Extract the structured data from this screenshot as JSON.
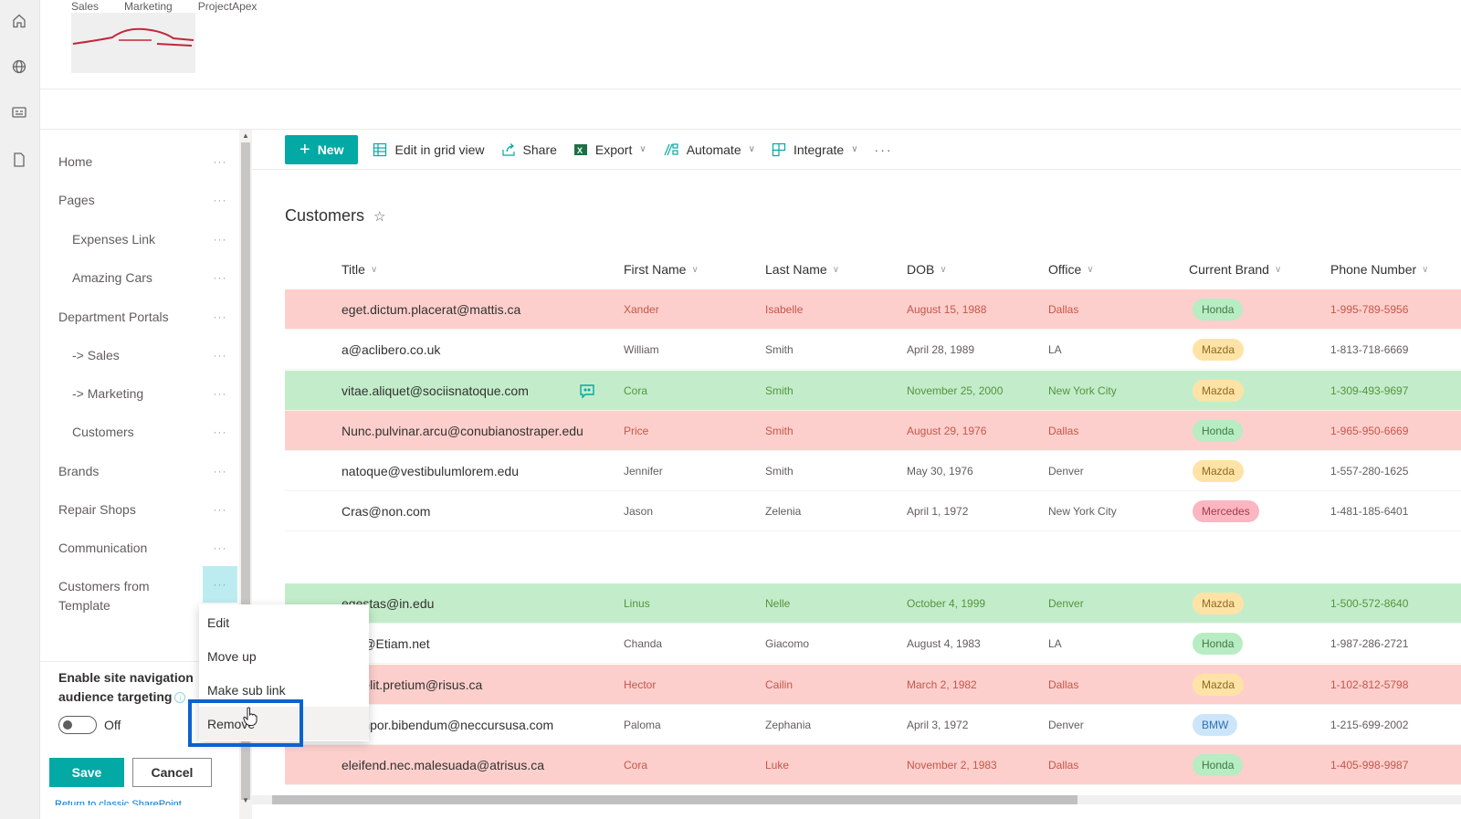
{
  "rail": {
    "icons": [
      "home-icon",
      "globe-icon",
      "news-icon",
      "document-icon"
    ]
  },
  "header": {
    "topnav": [
      "Sales",
      "Marketing",
      "ProjectApex"
    ],
    "logo": "car-logo"
  },
  "commandbar": {
    "new_label": "New",
    "edit_grid_label": "Edit in grid view",
    "share_label": "Share",
    "export_label": "Export",
    "automate_label": "Automate",
    "integrate_label": "Integrate",
    "more_label": "···"
  },
  "list": {
    "title": "Customers",
    "columns": [
      "Title",
      "First Name",
      "Last Name",
      "DOB",
      "Office",
      "Current Brand",
      "Phone Number"
    ],
    "rows": [
      {
        "title": "eget.dictum.placerat@mattis.ca",
        "first": "Xander",
        "last": "Isabelle",
        "dob": "August 15, 1988",
        "office": "Dallas",
        "brand": "Honda",
        "phone": "1-995-789-5956",
        "highlight": "red"
      },
      {
        "title": "a@aclibero.co.uk",
        "first": "William",
        "last": "Smith",
        "dob": "April 28, 1989",
        "office": "LA",
        "brand": "Mazda",
        "phone": "1-813-718-6669",
        "highlight": "none"
      },
      {
        "title": "vitae.aliquet@sociisnatoque.com",
        "first": "Cora",
        "last": "Smith",
        "dob": "November 25, 2000",
        "office": "New York City",
        "brand": "Mazda",
        "phone": "1-309-493-9697",
        "highlight": "green"
      },
      {
        "title": "Nunc.pulvinar.arcu@conubianostraper.edu",
        "first": "Price",
        "last": "Smith",
        "dob": "August 29, 1976",
        "office": "Dallas",
        "brand": "Honda",
        "phone": "1-965-950-6669",
        "highlight": "red"
      },
      {
        "title": "natoque@vestibulumlorem.edu",
        "first": "Jennifer",
        "last": "Smith",
        "dob": "May 30, 1976",
        "office": "Denver",
        "brand": "Mazda",
        "phone": "1-557-280-1625",
        "highlight": "none"
      },
      {
        "title": "Cras@non.com",
        "first": "Jason",
        "last": "Zelenia",
        "dob": "April 1, 1972",
        "office": "New York City",
        "brand": "Mercedes",
        "phone": "1-481-185-6401",
        "highlight": "none"
      },
      {
        "title": "egestas@in.edu",
        "first": "Linus",
        "last": "Nelle",
        "dob": "October 4, 1999",
        "office": "Denver",
        "brand": "Mazda",
        "phone": "1-500-572-8640",
        "highlight": "green"
      },
      {
        "title": "...m@Etiam.net",
        "first": "Chanda",
        "last": "Giacomo",
        "dob": "August 4, 1983",
        "office": "LA",
        "brand": "Honda",
        "phone": "1-987-286-2721",
        "highlight": "none"
      },
      {
        "title": "...a.elit.pretium@risus.ca",
        "first": "Hector",
        "last": "Cailin",
        "dob": "March 2, 1982",
        "office": "Dallas",
        "brand": "Mazda",
        "phone": "1-102-812-5798",
        "highlight": "red"
      },
      {
        "title": "...empor.bibendum@neccursusa.com",
        "first": "Paloma",
        "last": "Zephania",
        "dob": "April 3, 1972",
        "office": "Denver",
        "brand": "BMW",
        "phone": "1-215-699-2002",
        "highlight": "none"
      },
      {
        "title": "eleifend.nec.malesuada@atrisus.ca",
        "first": "Cora",
        "last": "Luke",
        "dob": "November 2, 1983",
        "office": "Dallas",
        "brand": "Honda",
        "phone": "1-405-998-9987",
        "highlight": "red"
      }
    ]
  },
  "navpane": {
    "items": [
      {
        "label": "Home",
        "sub": false
      },
      {
        "label": "Pages",
        "sub": false
      },
      {
        "label": "Expenses Link",
        "sub": true
      },
      {
        "label": "Amazing Cars",
        "sub": true
      },
      {
        "label": "Department Portals",
        "sub": false
      },
      {
        "label": "-> Sales",
        "sub": true
      },
      {
        "label": "-> Marketing",
        "sub": true
      },
      {
        "label": "Customers",
        "sub": true
      },
      {
        "label": "Brands",
        "sub": false
      },
      {
        "label": "Repair Shops",
        "sub": false
      },
      {
        "label": "Communication",
        "sub": false
      },
      {
        "label": "Customers from Template",
        "sub": false
      }
    ],
    "targeting_label": "Enable site navigation audience targeting",
    "toggle_state": "Off",
    "save_label": "Save",
    "cancel_label": "Cancel",
    "classic_link": "Return to classic SharePoint"
  },
  "context_menu": {
    "items": [
      "Edit",
      "Move up",
      "Make sub link",
      "Remove"
    ],
    "hovered": "Remove"
  }
}
